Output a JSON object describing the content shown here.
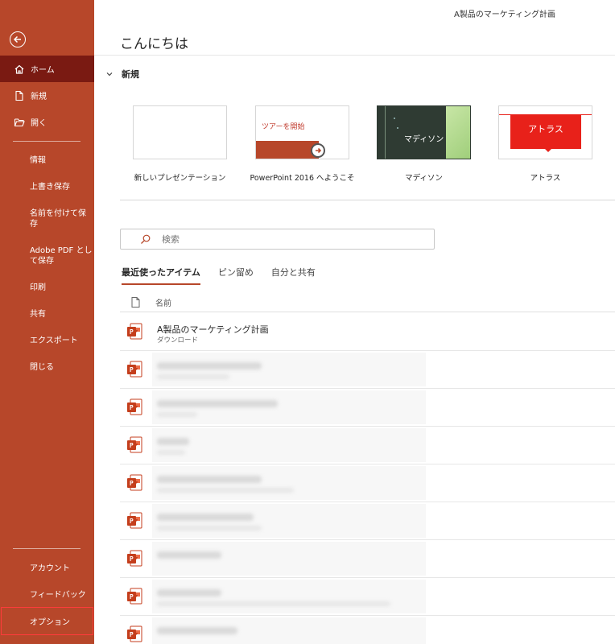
{
  "window": {
    "doc_title": "A製品のマーケティング計画"
  },
  "sidebar": {
    "top_items": [
      {
        "label": "ホーム",
        "icon": "home-icon",
        "active": true
      },
      {
        "label": "新規",
        "icon": "new-document-icon"
      },
      {
        "label": "開く",
        "icon": "folder-open-icon"
      }
    ],
    "mid_items": [
      {
        "label": "情報"
      },
      {
        "label": "上書き保存"
      },
      {
        "label": "名前を付けて保\n存"
      },
      {
        "label": "Adobe PDF とし\nて保存"
      },
      {
        "label": "印刷"
      },
      {
        "label": "共有"
      },
      {
        "label": "エクスポート"
      },
      {
        "label": "閉じる"
      }
    ],
    "bottom_items": [
      {
        "label": "アカウント"
      },
      {
        "label": "フィードバック"
      },
      {
        "label": "オプション"
      }
    ]
  },
  "main": {
    "greeting": "こんにちは",
    "new_section": {
      "label": "新規",
      "templates": [
        {
          "caption": "新しいプレゼンテーション"
        },
        {
          "caption": "PowerPoint 2016 へようこそ",
          "thumb_text": "ツアーを開始"
        },
        {
          "caption": "マディソン",
          "thumb_text": "マディソン"
        },
        {
          "caption": "アトラス",
          "thumb_text": "アトラス"
        }
      ]
    },
    "search": {
      "placeholder": "検索"
    },
    "tabs": [
      {
        "label": "最近使ったアイテム",
        "active": true
      },
      {
        "label": "ピン留め"
      },
      {
        "label": "自分と共有"
      }
    ],
    "list": {
      "header_name": "名前",
      "rows": [
        {
          "name": "A製品のマーケティング計画",
          "sub": "ダウンロード"
        }
      ]
    }
  },
  "colors": {
    "brand": "#b7472a",
    "active_nav": "#7a1a12",
    "annotation": "#ff3b3b"
  }
}
